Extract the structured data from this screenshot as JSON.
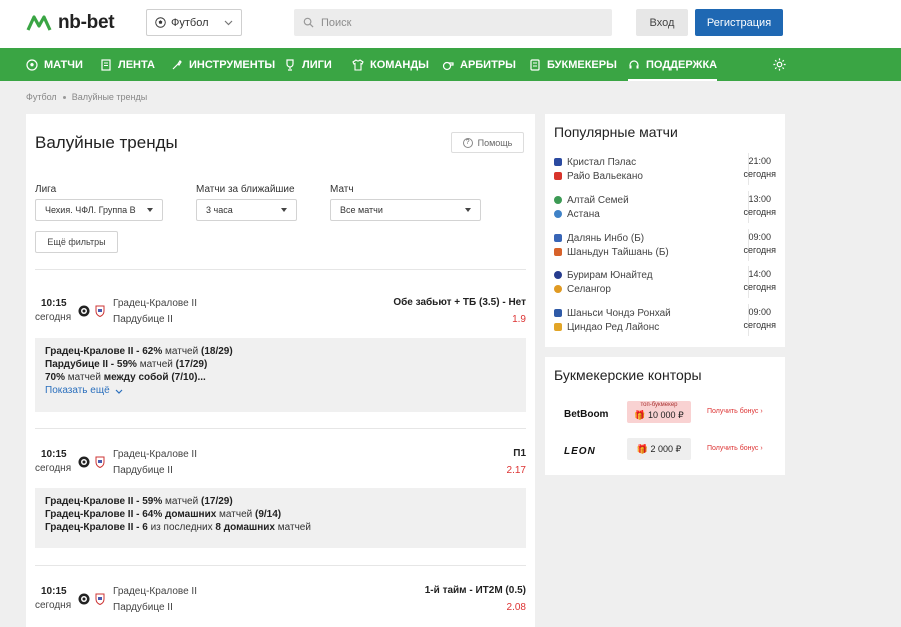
{
  "header": {
    "logo_text": "nb-bet",
    "sport_select": "Футбол",
    "search_placeholder": "Поиск",
    "login_label": "Вход",
    "register_label": "Регистрация"
  },
  "nav": {
    "items": [
      {
        "label": "МАТЧИ",
        "icon": "ball-icon"
      },
      {
        "label": "ЛЕНТА",
        "icon": "list-icon"
      },
      {
        "label": "ИНСТРУМЕНТЫ",
        "icon": "tools-icon"
      },
      {
        "label": "ЛИГИ",
        "icon": "trophy-icon"
      },
      {
        "label": "КОМАНДЫ",
        "icon": "shirt-icon"
      },
      {
        "label": "АРБИТРЫ",
        "icon": "whistle-icon"
      },
      {
        "label": "БУКМЕКЕРЫ",
        "icon": "bookmaker-icon"
      },
      {
        "label": "ПОДДЕРЖКА",
        "icon": "headset-icon"
      }
    ],
    "active_index": 7
  },
  "breadcrumb": [
    "Футбол",
    "Валуйные тренды"
  ],
  "main": {
    "title": "Валуйные тренды",
    "help_label": "Помощь",
    "filters": {
      "league": {
        "label": "Лига",
        "value": "Чехия. ЧФЛ. Группа B"
      },
      "upcoming": {
        "label": "Матчи за ближайшие",
        "value": "3 часа"
      },
      "match": {
        "label": "Матч",
        "value": "Все матчи"
      },
      "more_label": "Ещё фильтры"
    },
    "matches": [
      {
        "time": "10:15",
        "day": "сегодня",
        "team1": "Градец-Кралове II",
        "team2": "Пардубице II",
        "market": "Обе забьют + ТБ (3.5) - Нет",
        "odds": "1.9",
        "trends": [
          {
            "bold": "Градец-Кралове II - 62%",
            "normal": " матчей ",
            "bold2": "(18/29)"
          },
          {
            "bold": "Пардубице II - 59%",
            "normal": " матчей ",
            "bold2": "(17/29)"
          },
          {
            "bold": "70%",
            "normal": " матчей ",
            "bold2": "между собой (7/10)..."
          }
        ],
        "show_more": "Показать ещё"
      },
      {
        "time": "10:15",
        "day": "сегодня",
        "team1": "Градец-Кралове II",
        "team2": "Пардубице II",
        "market": "П1",
        "odds": "2.17",
        "trends": [
          {
            "bold": "Градец-Кралове II - 59%",
            "normal": " матчей ",
            "bold2": "(17/29)"
          },
          {
            "bold": "Градец-Кралове II - 64% домашних",
            "normal": " матчей ",
            "bold2": "(9/14)"
          },
          {
            "bold": "Градец-Кралове II - 6",
            "normal": " из последних ",
            "bold2": "8 домашних",
            "tail": " матчей"
          }
        ]
      },
      {
        "time": "10:15",
        "day": "сегодня",
        "team1": "Градец-Кралове II",
        "team2": "Пардубице II",
        "market": "1-й тайм - ИТ2М (0.5)",
        "odds": "2.08"
      }
    ]
  },
  "popular": {
    "title": "Популярные матчи",
    "matches": [
      {
        "team1": "Кристал Пэлас",
        "team2": "Райо Вальекано",
        "time": "21:00",
        "day": "сегодня",
        "c1": "#2b4aa0",
        "c2": "#d8342b"
      },
      {
        "team1": "Алтай Семей",
        "team2": "Астана",
        "time": "13:00",
        "day": "сегодня",
        "c1": "#3c9a54",
        "c2": "#3f82c7"
      },
      {
        "team1": "Далянь Инбо (Б)",
        "team2": "Шаньдун Тайшань (Б)",
        "time": "09:00",
        "day": "сегодня",
        "c1": "#3865b6",
        "c2": "#d7622a"
      },
      {
        "team1": "Бурирам Юнайтед",
        "team2": "Селангор",
        "time": "14:00",
        "day": "сегодня",
        "c1": "#263c8e",
        "c2": "#e09a23"
      },
      {
        "team1": "Шаньси Чондэ Ронхай",
        "team2": "Циндао Ред Лайонс",
        "time": "09:00",
        "day": "сегодня",
        "c1": "#2f5aa7",
        "c2": "#e2a527"
      }
    ]
  },
  "bookmakers": {
    "title": "Букмекерские конторы",
    "items": [
      {
        "name": "BetBoom",
        "tag": "топ-букмекер",
        "amount": "10 000 ₽",
        "bonus": "Получить бонус"
      },
      {
        "name": "LEON",
        "tag": "",
        "amount": "2 000 ₽",
        "bonus": "Получить бонус"
      }
    ]
  },
  "colors": {
    "accent_green": "#3aa544",
    "brand_blue": "#1f68b3",
    "odds_red": "#dd3333",
    "link_blue": "#2a6fbd"
  }
}
